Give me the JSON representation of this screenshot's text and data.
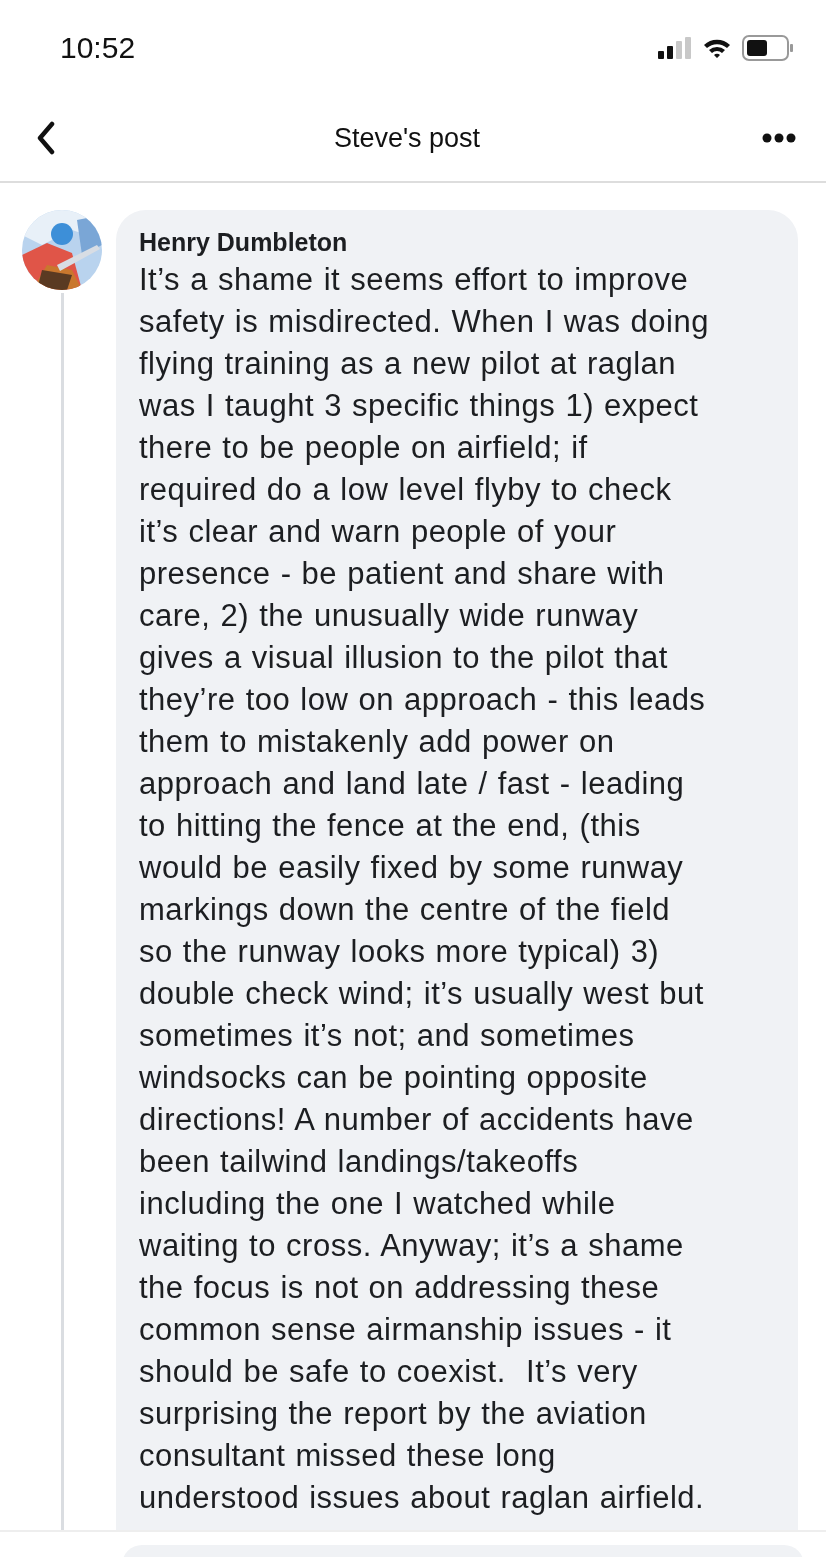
{
  "status_bar": {
    "time": "10:52"
  },
  "nav": {
    "title": "Steve's post"
  },
  "comment": {
    "author": "Henry Dumbleton",
    "text": "It’s a shame it seems effort to improve\nsafety is misdirected. When I was doing\nflying training as a new pilot at raglan\nwas I taught 3 specific things 1) expect\nthere to be people on airfield; if\nrequired do a low level flyby to check\nit’s clear and warn people of your\npresence - be patient and share with\ncare, 2) the unusually wide runway\ngives a visual illusion to the pilot that\nthey’re too low on approach - this leads\nthem to mistakenly add power on\napproach and land late / fast - leading\nto hitting the fence at the end, (this\nwould be easily fixed by some runway\nmarkings down the centre of the field\nso the runway looks more typical) 3)\ndouble check wind; it’s usually west but\nsometimes it’s not; and sometimes\nwindsocks can be pointing opposite\ndirections! A number of accidents have\nbeen tailwind landings/takeoffs\nincluding the one I watched while\nwaiting to cross. Anyway; it’s a shame\nthe focus is not on addressing these\ncommon sense airmanship issues - it\nshould be safe to coexist.  It’s very\nsurprising the report by the aviation\nconsultant missed these long\nunderstood issues about raglan airfield."
  }
}
